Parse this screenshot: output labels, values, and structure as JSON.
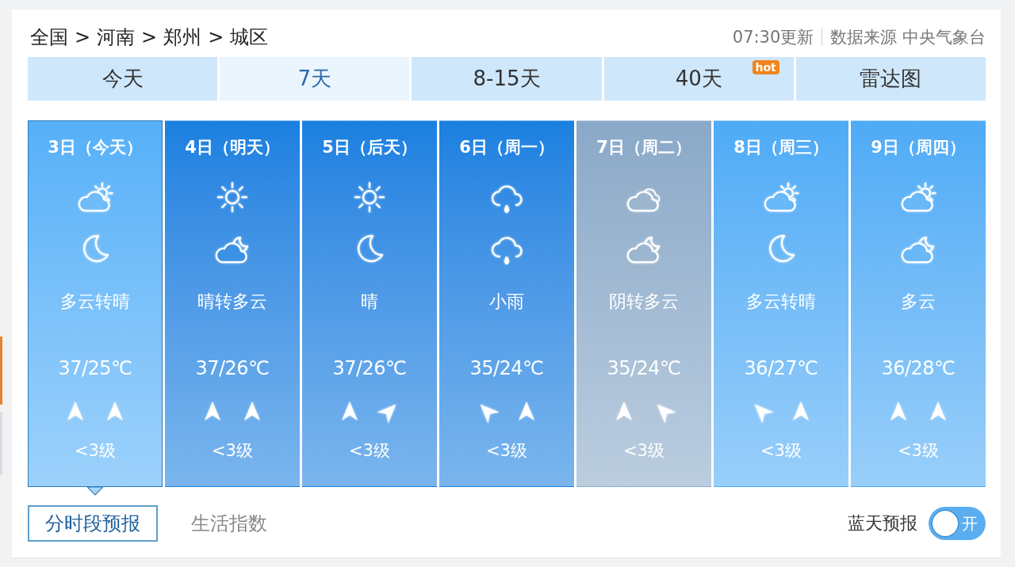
{
  "breadcrumb": {
    "items": [
      "全国",
      "河南",
      "郑州",
      "城区"
    ],
    "separator": ">"
  },
  "update_time": "07:30更新",
  "source": "数据来源 中央气象台",
  "tabs": [
    {
      "label": "今天",
      "selected": false
    },
    {
      "label": "7天",
      "selected": true
    },
    {
      "label": "8-15天",
      "selected": false
    },
    {
      "label": "40天",
      "selected": false,
      "badge": "hot"
    },
    {
      "label": "雷达图",
      "selected": false
    }
  ],
  "days": [
    {
      "date": "3日（今天）",
      "selected": true,
      "color": "#55b0f8",
      "icons": [
        {
          "kind": "cloud-sun"
        },
        {
          "kind": "moon"
        }
      ],
      "weather": "多云转晴",
      "temp": "37/25℃",
      "winds": [
        {
          "kind": "n"
        },
        {
          "kind": "n"
        }
      ],
      "wind_level": "<3级"
    },
    {
      "date": "4日（明天）",
      "selected": false,
      "color": "#1a80e0",
      "icons": [
        {
          "kind": "sun"
        },
        {
          "kind": "cloud-moon"
        }
      ],
      "weather": "晴转多云",
      "temp": "37/26℃",
      "winds": [
        {
          "kind": "n"
        },
        {
          "kind": "n"
        }
      ],
      "wind_level": "<3级"
    },
    {
      "date": "5日（后天）",
      "selected": false,
      "color": "#1a80e0",
      "icons": [
        {
          "kind": "sun"
        },
        {
          "kind": "moon"
        }
      ],
      "weather": "晴",
      "temp": "37/26℃",
      "winds": [
        {
          "kind": "n"
        },
        {
          "kind": "ne"
        }
      ],
      "wind_level": "<3级"
    },
    {
      "date": "6日（周一）",
      "selected": false,
      "color": "#1a80e0",
      "icons": [
        {
          "kind": "rain"
        },
        {
          "kind": "rain"
        }
      ],
      "weather": "小雨",
      "temp": "35/24℃",
      "winds": [
        {
          "kind": "nw"
        },
        {
          "kind": "n"
        }
      ],
      "wind_level": "<3级"
    },
    {
      "date": "7日（周二）",
      "selected": false,
      "color": "#8aa9c8",
      "icons": [
        {
          "kind": "cloudy"
        },
        {
          "kind": "cloud-moon"
        }
      ],
      "weather": "阴转多云",
      "temp": "35/24℃",
      "winds": [
        {
          "kind": "n"
        },
        {
          "kind": "nw"
        }
      ],
      "wind_level": "<3级"
    },
    {
      "date": "8日（周三）",
      "selected": false,
      "color": "#4eabf6",
      "icons": [
        {
          "kind": "cloud-sun"
        },
        {
          "kind": "moon"
        }
      ],
      "weather": "多云转晴",
      "temp": "36/27℃",
      "winds": [
        {
          "kind": "nw"
        },
        {
          "kind": "n"
        }
      ],
      "wind_level": "<3级"
    },
    {
      "date": "9日（周四）",
      "selected": false,
      "color": "#4eabf6",
      "icons": [
        {
          "kind": "cloud-sun"
        },
        {
          "kind": "cloud-moon"
        }
      ],
      "weather": "多云",
      "temp": "36/28℃",
      "winds": [
        {
          "kind": "n"
        },
        {
          "kind": "n"
        }
      ],
      "wind_level": "<3级"
    }
  ],
  "subtabs": [
    {
      "label": "分时段预报",
      "selected": true
    },
    {
      "label": "生活指数",
      "selected": false
    }
  ],
  "blue_sky": {
    "label": "蓝天预报",
    "on": true,
    "text": "开"
  }
}
